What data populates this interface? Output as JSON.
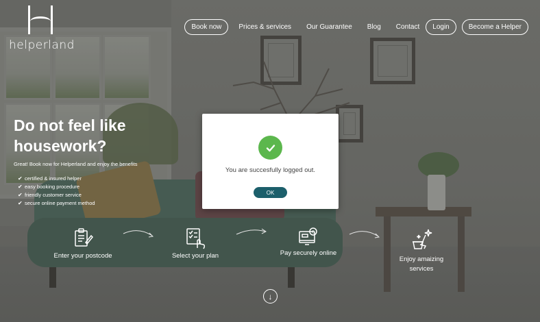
{
  "brand": {
    "name": "helperland"
  },
  "nav": {
    "book_now": "Book now",
    "prices": "Prices & services",
    "guarantee": "Our Guarantee",
    "blog": "Blog",
    "contact": "Contact",
    "login": "Login",
    "become_helper": "Become a Helper"
  },
  "hero": {
    "title_line1": "Do not feel like",
    "title_line2": "housework?",
    "subtitle": "Great! Book now for Helperland and enjoy the benefits",
    "benefits": [
      "certified & insured helper",
      "easy booking procedure",
      "friendly customer service",
      "secure online payment method"
    ]
  },
  "steps": [
    {
      "label": "Enter your postcode",
      "icon": "clipboard-icon"
    },
    {
      "label": "Select your plan",
      "icon": "plan-select-icon"
    },
    {
      "label": "Pay securely online",
      "icon": "payment-icon"
    },
    {
      "label_line1": "Enjoy amaizing",
      "label_line2": "services",
      "icon": "cleaning-icon"
    }
  ],
  "modal": {
    "message": "You are succesfully logged out.",
    "ok_label": "OK",
    "icon": "check-icon",
    "accent_color": "#5cb74d",
    "button_color": "#1c5f6b"
  },
  "scroll": {
    "icon": "arrow-down-circle-icon"
  }
}
